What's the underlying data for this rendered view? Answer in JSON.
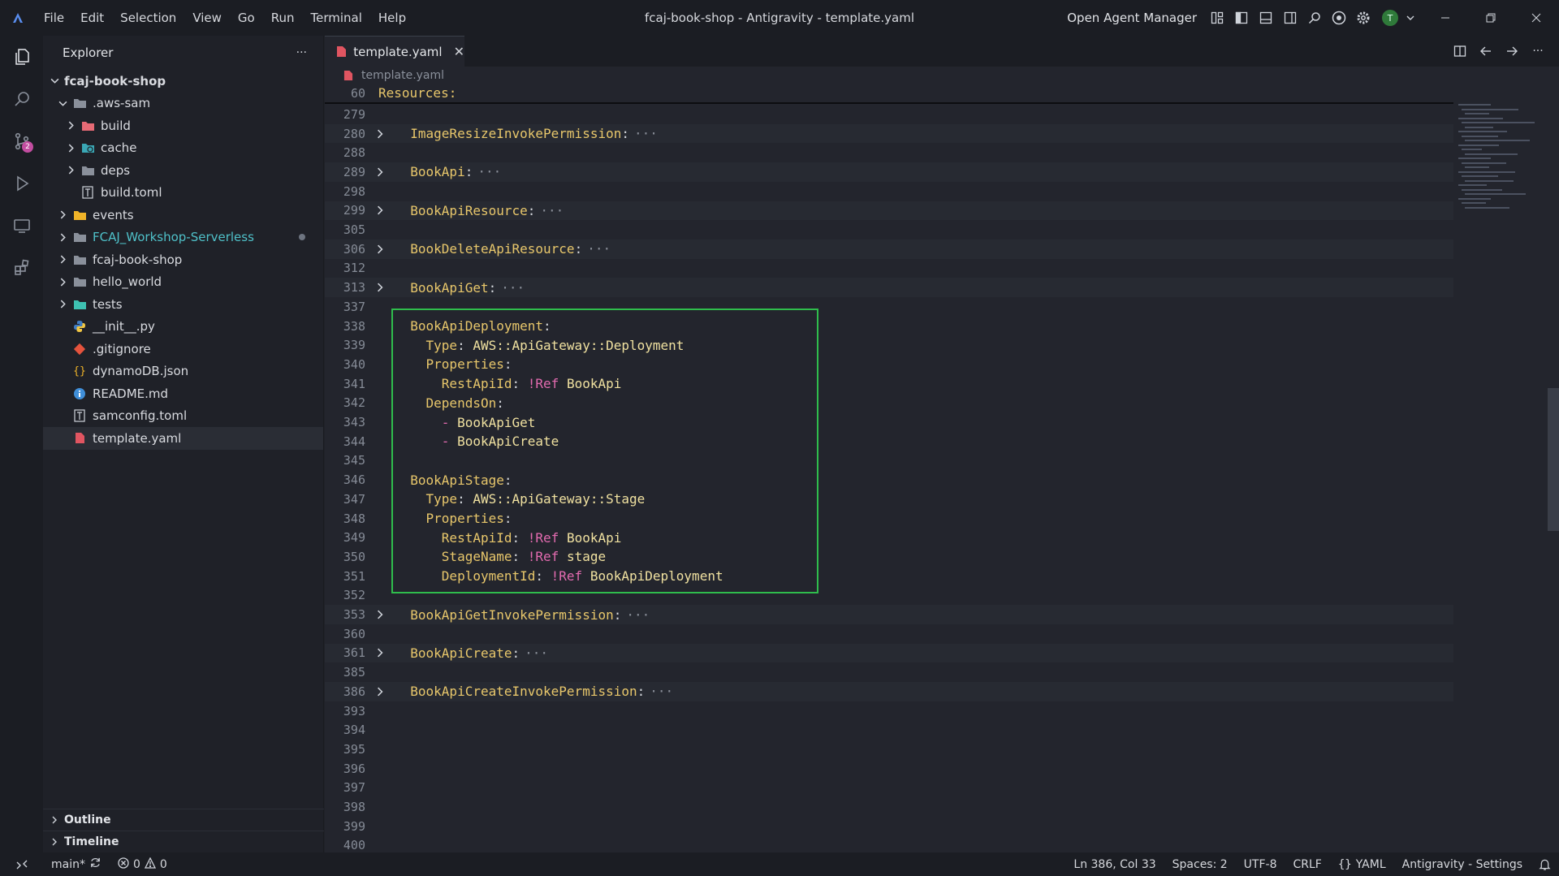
{
  "window": {
    "title": "fcaj-book-shop - Antigravity - template.yaml"
  },
  "menu": [
    "File",
    "Edit",
    "Selection",
    "View",
    "Go",
    "Run",
    "Terminal",
    "Help"
  ],
  "titlebar_right": {
    "agent_manager": "Open Agent Manager",
    "avatar_initial": "T"
  },
  "activity_bar": {
    "source_control_badge": "2"
  },
  "explorer": {
    "title": "Explorer",
    "more": "···",
    "root": "fcaj-book-shop",
    "items": [
      {
        "label": ".aws-sam",
        "icon": "folder-open-icon"
      },
      {
        "label": "build",
        "icon": "folder-build-icon"
      },
      {
        "label": "cache",
        "icon": "folder-cache-icon"
      },
      {
        "label": "deps",
        "icon": "folder-icon"
      },
      {
        "label": "build.toml",
        "icon": "toml-file-icon"
      },
      {
        "label": "events",
        "icon": "folder-events-icon"
      },
      {
        "label": "FCAJ_Workshop-Serverless",
        "icon": "folder-icon"
      },
      {
        "label": "fcaj-book-shop",
        "icon": "folder-icon"
      },
      {
        "label": "hello_world",
        "icon": "folder-icon"
      },
      {
        "label": "tests",
        "icon": "folder-tests-icon"
      },
      {
        "label": "__init__.py",
        "icon": "python-file-icon"
      },
      {
        "label": ".gitignore",
        "icon": "git-file-icon"
      },
      {
        "label": "dynamoDB.json",
        "icon": "json-file-icon"
      },
      {
        "label": "README.md",
        "icon": "info-file-icon"
      },
      {
        "label": "samconfig.toml",
        "icon": "toml-file-icon"
      },
      {
        "label": "template.yaml",
        "icon": "yaml-file-icon"
      }
    ],
    "sections": {
      "outline": "Outline",
      "timeline": "Timeline"
    }
  },
  "editor": {
    "tab_label": "template.yaml",
    "breadcrumb": "template.yaml",
    "sticky": {
      "ln": "60",
      "text": "Resources:"
    },
    "lines": [
      {
        "ln": "279",
        "tokens": []
      },
      {
        "ln": "280",
        "fold": true,
        "tokens": [
          {
            "c": "k-key",
            "t": "  ImageResizeInvokePermission"
          },
          {
            "c": "",
            "t": ":"
          }
        ]
      },
      {
        "ln": "288",
        "tokens": []
      },
      {
        "ln": "289",
        "fold": true,
        "tokens": [
          {
            "c": "k-key",
            "t": "  BookApi"
          },
          {
            "c": "",
            "t": ":"
          }
        ]
      },
      {
        "ln": "298",
        "tokens": []
      },
      {
        "ln": "299",
        "fold": true,
        "tokens": [
          {
            "c": "k-key",
            "t": "  BookApiResource"
          },
          {
            "c": "",
            "t": ":"
          }
        ]
      },
      {
        "ln": "305",
        "tokens": []
      },
      {
        "ln": "306",
        "fold": true,
        "tokens": [
          {
            "c": "k-key",
            "t": "  BookDeleteApiResource"
          },
          {
            "c": "",
            "t": ":"
          }
        ]
      },
      {
        "ln": "312",
        "tokens": []
      },
      {
        "ln": "313",
        "fold": true,
        "tokens": [
          {
            "c": "k-key",
            "t": "  BookApiGet"
          },
          {
            "c": "",
            "t": ":"
          }
        ]
      },
      {
        "ln": "337",
        "tokens": []
      },
      {
        "ln": "338",
        "tokens": [
          {
            "c": "k-key",
            "t": "  BookApiDeployment"
          },
          {
            "c": "",
            "t": ":"
          }
        ]
      },
      {
        "ln": "339",
        "tokens": [
          {
            "c": "k-key",
            "t": "    Type"
          },
          {
            "c": "",
            "t": ": "
          },
          {
            "c": "k-val",
            "t": "AWS::ApiGateway::Deployment"
          }
        ]
      },
      {
        "ln": "340",
        "tokens": [
          {
            "c": "k-key",
            "t": "    Properties"
          },
          {
            "c": "",
            "t": ":"
          }
        ]
      },
      {
        "ln": "341",
        "tokens": [
          {
            "c": "k-key",
            "t": "      RestApiId"
          },
          {
            "c": "",
            "t": ": "
          },
          {
            "c": "k-tag",
            "t": "!Ref "
          },
          {
            "c": "k-val",
            "t": "BookApi"
          }
        ]
      },
      {
        "ln": "342",
        "tokens": [
          {
            "c": "k-key",
            "t": "    DependsOn"
          },
          {
            "c": "",
            "t": ":"
          }
        ]
      },
      {
        "ln": "343",
        "tokens": [
          {
            "c": "k-dash",
            "t": "      - "
          },
          {
            "c": "k-val",
            "t": "BookApiGet"
          }
        ]
      },
      {
        "ln": "344",
        "tokens": [
          {
            "c": "k-dash",
            "t": "      - "
          },
          {
            "c": "k-val",
            "t": "BookApiCreate"
          }
        ]
      },
      {
        "ln": "345",
        "tokens": []
      },
      {
        "ln": "346",
        "tokens": [
          {
            "c": "k-key",
            "t": "  BookApiStage"
          },
          {
            "c": "",
            "t": ":"
          }
        ]
      },
      {
        "ln": "347",
        "tokens": [
          {
            "c": "k-key",
            "t": "    Type"
          },
          {
            "c": "",
            "t": ": "
          },
          {
            "c": "k-val",
            "t": "AWS::ApiGateway::Stage"
          }
        ]
      },
      {
        "ln": "348",
        "tokens": [
          {
            "c": "k-key",
            "t": "    Properties"
          },
          {
            "c": "",
            "t": ":"
          }
        ]
      },
      {
        "ln": "349",
        "tokens": [
          {
            "c": "k-key",
            "t": "      RestApiId"
          },
          {
            "c": "",
            "t": ": "
          },
          {
            "c": "k-tag",
            "t": "!Ref "
          },
          {
            "c": "k-val",
            "t": "BookApi"
          }
        ]
      },
      {
        "ln": "350",
        "tokens": [
          {
            "c": "k-key",
            "t": "      StageName"
          },
          {
            "c": "",
            "t": ": "
          },
          {
            "c": "k-tag",
            "t": "!Ref "
          },
          {
            "c": "k-val",
            "t": "stage"
          }
        ]
      },
      {
        "ln": "351",
        "tokens": [
          {
            "c": "k-key",
            "t": "      DeploymentId"
          },
          {
            "c": "",
            "t": ": "
          },
          {
            "c": "k-tag",
            "t": "!Ref "
          },
          {
            "c": "k-val",
            "t": "BookApiDeployment"
          }
        ]
      },
      {
        "ln": "352",
        "tokens": []
      },
      {
        "ln": "353",
        "fold": true,
        "tokens": [
          {
            "c": "k-key",
            "t": "  BookApiGetInvokePermission"
          },
          {
            "c": "",
            "t": ":"
          }
        ]
      },
      {
        "ln": "360",
        "tokens": []
      },
      {
        "ln": "361",
        "fold": true,
        "tokens": [
          {
            "c": "k-key",
            "t": "  BookApiCreate"
          },
          {
            "c": "",
            "t": ":"
          }
        ]
      },
      {
        "ln": "385",
        "tokens": []
      },
      {
        "ln": "386",
        "fold": true,
        "tokens": [
          {
            "c": "k-key",
            "t": "  BookApiCreateInvokePermission"
          },
          {
            "c": "",
            "t": ":"
          }
        ]
      },
      {
        "ln": "393",
        "tokens": []
      },
      {
        "ln": "394",
        "tokens": []
      },
      {
        "ln": "395",
        "tokens": []
      },
      {
        "ln": "396",
        "tokens": []
      },
      {
        "ln": "397",
        "tokens": []
      },
      {
        "ln": "398",
        "tokens": []
      },
      {
        "ln": "399",
        "tokens": []
      },
      {
        "ln": "400",
        "tokens": []
      }
    ],
    "fold_ellipsis": "···"
  },
  "status": {
    "branch": "main*",
    "errors": "0",
    "warnings": "0",
    "cursor": "Ln 386, Col 33",
    "spaces": "Spaces: 2",
    "encoding": "UTF-8",
    "eol": "CRLF",
    "language": "YAML",
    "settings": "Antigravity - Settings"
  },
  "colors": {
    "highlight_box": "#2fbd4c",
    "accent_badge": "#c24da0"
  }
}
